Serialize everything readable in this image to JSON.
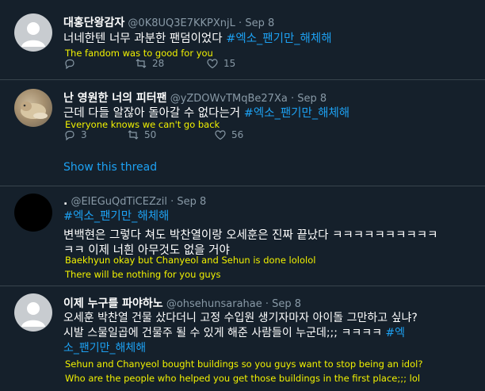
{
  "tweets": [
    {
      "name": "대홍단왕감자",
      "handle": "@0K8UQ3E7KKPXnjL",
      "date": "Sep 8",
      "text": "너네한텐 너무 과분한 팬덤이었다 ",
      "hashtag": "#엑소_팬기만_해체해",
      "subtitle": "The fandom was to good for you",
      "retweets": "28",
      "likes": "15"
    },
    {
      "name": "난 영원한 너의 피터팬",
      "handle": "@yZDOWvTMqBe27Xa",
      "date": "Sep 8",
      "text": "근데 다들 알잖아 돌아갈 수 없다는거 ",
      "hashtag": "#엑소_팬기만_해체해",
      "subtitle": "Everyone knows we can't go back",
      "replies": "3",
      "retweets": "50",
      "likes": "56",
      "show_thread": "Show this thread"
    },
    {
      "name": ".",
      "handle": "@EIEGuQdTiCEZzil",
      "date": "Sep 8",
      "hashtag": "#엑소_팬기만_해체해",
      "line1": "변백현은 그렇다 쳐도 박찬열이랑 오세훈은 진짜 끝났다 ㅋㅋㅋㅋㅋㅋㅋㅋㅋㅋ",
      "line2": "ㅋㅋ 이제 너흰 아무것도 없을 거야",
      "subtitle1": "Baekhyun okay but Chanyeol and Sehun is done lololol",
      "subtitle2": "There will be nothing for you guys"
    },
    {
      "name": "이제 누구를 파야하노",
      "handle": "@ohsehunsarahae",
      "date": "Sep 8",
      "line1": "오세훈 박찬열 건물 샀다더니 고정 수입원 생기자마자 아이돌 그만하고 싶냐?",
      "line2": "시발 스물일곱에 건물주 될 수 있게 해준 사람들이 누군데;;; ㅋㅋㅋㅋ ",
      "hashtag_a": "#엑",
      "hashtag_b": "소_팬기만_해체해",
      "subtitle1": "Sehun and Chanyeol bought buildings so you guys want to stop being an idol?",
      "subtitle2": "Who are the people who helped you get those buildings in the first place;;; lol"
    }
  ],
  "dot": "·",
  "colors": {
    "background": "#15202b",
    "accent": "#1da1f2",
    "muted": "#8899a6",
    "subtitle": "#f2f200"
  }
}
